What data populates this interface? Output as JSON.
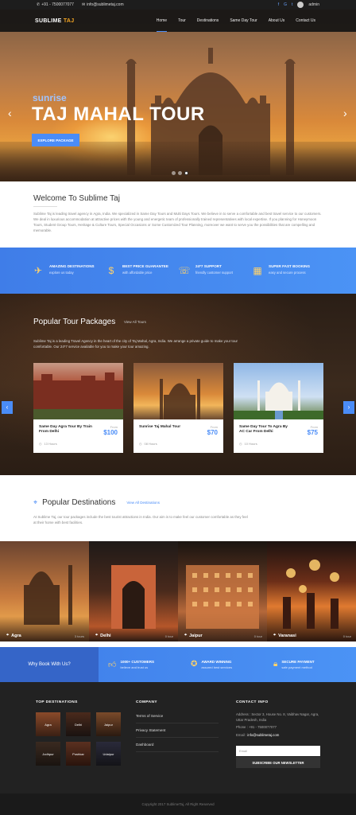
{
  "topbar": {
    "phone": "+91 - 7500077077",
    "email": "info@sublimetaj.com",
    "user": "admin",
    "social": [
      "f",
      "G",
      "t"
    ]
  },
  "navbar": {
    "brand_main": "SUBLIME",
    "brand_accent": "TAJ",
    "items": [
      {
        "label": "Home"
      },
      {
        "label": "Tour"
      },
      {
        "label": "Destinations"
      },
      {
        "label": "Same Day Tour"
      },
      {
        "label": "About Us"
      },
      {
        "label": "Contact Us"
      }
    ]
  },
  "hero": {
    "subtitle": "sunrise",
    "title": "TAJ MAHAL TOUR",
    "button": "EXPLORE PACKAGE",
    "prev": "‹",
    "next": "›"
  },
  "welcome": {
    "title": "Welcome To Sublime Taj",
    "text": "Sublime Taj is leading travel agency in Agra, India. We specialized in Same Day Tours and Multi Days Tours. We believe in to serve a comfortable and best travel service to our customers. We deal in luxurious accommodation at attractive prices with the young and energetic team of professionally trained representatives with local expertise. If you planning for Honeymoon Tours, Student Group Tours, Heritage & Culture Tours, Special Occasions or Some Customized Tour Planning, moreover we want to serve you the possibilities that are compelling and memorable."
  },
  "features": [
    {
      "title": "AMAZING DESTINATIONS",
      "desc": "explore us today",
      "icon": "map-icon"
    },
    {
      "title": "BEST PRICE GUARANTEE",
      "desc": "with affordable price",
      "icon": "price-tag-icon"
    },
    {
      "title": "24*7 SUPPORT",
      "desc": "friendly customer support",
      "icon": "support-icon"
    },
    {
      "title": "SUPER FAST BOOKING",
      "desc": "easy and secure process",
      "icon": "calendar-icon"
    }
  ],
  "packages": {
    "title": "Popular Tour Packages",
    "view_all": "View All Tours",
    "desc": "Sublime Taj is a leading Travel Agency in the heart of the city of Taj Mahal, Agra, India. We arrange a private guide to make your tour comfortable. Our 24*7 service available for you to make your tour amazing.",
    "from_label": "From",
    "prev": "‹",
    "next": "›",
    "cards": [
      {
        "name": "Same Day Agra Tour By Train From Delhi",
        "price": "$100",
        "hours": "13 Hours"
      },
      {
        "name": "Sunrise Taj Mahal Tour",
        "price": "$70",
        "hours": "08 Hours"
      },
      {
        "name": "Same Day Tour To Agra By AC Car From Delhi",
        "price": "$75",
        "hours": "10 Hours"
      }
    ]
  },
  "destinations": {
    "title": "Popular Destinations",
    "view_all": "View All Destinations",
    "desc": "At Sublime Taj, our tour packages include the best tourist attractions in India. Our aim is to make feel our customer comfortable as they feel at their home with best facilities.",
    "items": [
      {
        "name": "Agra",
        "tours": "3 tours"
      },
      {
        "name": "Delhi",
        "tours": "0 tour"
      },
      {
        "name": "Jaipur",
        "tours": "0 tour"
      },
      {
        "name": "Varanasi",
        "tours": "0 tour"
      }
    ]
  },
  "why": {
    "title": "Why Book With Us?",
    "items": [
      {
        "title": "1000+ CUSTOMERS",
        "desc": "believe and trust us",
        "icon": "thumbs-up-icon"
      },
      {
        "title": "AWARD WINNING",
        "desc": "assured best services",
        "icon": "award-icon"
      },
      {
        "title": "SECURE PAYMENT",
        "desc": "safe payment method",
        "icon": "lock-icon"
      }
    ]
  },
  "footer": {
    "col1_title": "TOP DESTINATIONS",
    "thumbs": [
      "Agra",
      "Delhi",
      "Jaipur",
      "Jodhpur",
      "Pushkar",
      "Udaipur"
    ],
    "col2_title": "COMPANY",
    "links": [
      "Terms of Service",
      "Privacy Statement",
      "Dashboard"
    ],
    "col3_title": "CONTACT INFO",
    "address": "Address : Sector 3, House No. 8, Vaibhav Nagar, Agra, Uttar Pradesh, India",
    "phone": "Phone : +91 - 7500077077",
    "email_label": "Email :",
    "email": "info@sublimetaj.com",
    "email_placeholder": "Email",
    "subscribe": "SUBSCRIBE OUR NEWSLETTER",
    "copyright": "Copyright 2017 SublimeTaj, All Right Reserved"
  }
}
